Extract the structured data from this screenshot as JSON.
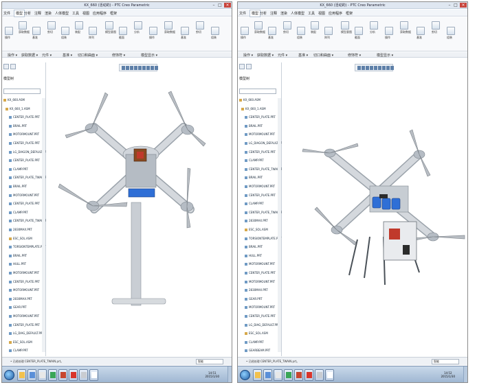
{
  "windows": [
    {
      "title": "KX_660 (活动的) - PTC Creo Parametric",
      "menu": [
        "文件",
        "模型",
        "分析",
        "注释",
        "渲染",
        "人体模型",
        "工具",
        "视图",
        "应用程序",
        "框架"
      ],
      "active_menu": 1,
      "ribbon_labels": [
        "操作",
        "获取数据",
        "基准",
        "剪切",
        "组装",
        "装配",
        "阵列",
        "模型意图",
        "截面",
        "分析"
      ],
      "group_labels": [
        "操作 ▾",
        "获取数据 ▾",
        "元件 ▾",
        "基准 ▾",
        "切口和曲面 ▾",
        "修饰符 ▾",
        "模型显示 ▾"
      ],
      "nav_header": "模型树",
      "tree": [
        {
          "label": "KX_660.ASM",
          "type": "asm"
        },
        {
          "label": "KX_660_1.ASM",
          "type": "asm"
        },
        {
          "label": "CENTER_PLATE.PRT",
          "type": "prt"
        },
        {
          "label": "BRAIL.PRT",
          "type": "prt"
        },
        {
          "label": "MOTORMOUNT.PRT",
          "type": "prt"
        },
        {
          "label": "CENTER_PLATE.PRT",
          "type": "prt"
        },
        {
          "label": "LG_DIAGON_DEFAULT.PRT",
          "type": "prt"
        },
        {
          "label": "CENTER_PLATE.PRT",
          "type": "prt"
        },
        {
          "label": "CLAMP.PRT",
          "type": "prt"
        },
        {
          "label": "CENTER_PLATE_TWAIN.PRT",
          "type": "prt"
        },
        {
          "label": "BRAIL.PRT",
          "type": "prt"
        },
        {
          "label": "MOTORMOUNT.PRT",
          "type": "prt"
        },
        {
          "label": "CENTER_PLATE.PRT",
          "type": "prt"
        },
        {
          "label": "CLAMP.PRT",
          "type": "prt"
        },
        {
          "label": "CENTER_PLATE_TWAIN.PRT",
          "type": "prt"
        },
        {
          "label": "2830MAX.PRT",
          "type": "prt"
        },
        {
          "label": "ESC_SOL.ASM",
          "type": "asm"
        },
        {
          "label": "TORSIONTEMPLATE.PRT",
          "type": "prt"
        },
        {
          "label": "BRAIL.PRT",
          "type": "prt"
        },
        {
          "label": "HULL.PRT",
          "type": "prt"
        },
        {
          "label": "MOTORMOUNT.PRT",
          "type": "prt"
        },
        {
          "label": "CENTER_PLATE.PRT",
          "type": "prt"
        },
        {
          "label": "MOTORMOUNT.PRT",
          "type": "prt"
        },
        {
          "label": "2830MAX.PRT",
          "type": "prt"
        },
        {
          "label": "GEAR.PRT",
          "type": "prt"
        },
        {
          "label": "MOTORMOUNT.PRT",
          "type": "prt"
        },
        {
          "label": "CENTER_PLATE.PRT",
          "type": "prt"
        },
        {
          "label": "LG_DIAG_DEFAULT.PRT",
          "type": "prt"
        },
        {
          "label": "ESC_SOL.ASM",
          "type": "asm"
        },
        {
          "label": "CLAMP.PRT",
          "type": "prt"
        },
        {
          "label": "GEARBEAM.PRT",
          "type": "prt"
        }
      ],
      "status": "• 已经处理 CENTER_PLATE_TWAIN.prt。",
      "selector": "智能",
      "clock": [
        "14:51",
        "2015/1/30"
      ]
    },
    {
      "title": "KX_660 (活动的) - PTC Creo Parametric",
      "menu": [
        "文件",
        "模型",
        "分析",
        "注释",
        "渲染",
        "人体模型",
        "工具",
        "视图",
        "应用程序",
        "框架"
      ],
      "active_menu": 1,
      "ribbon_labels": [
        "操作",
        "获取数据",
        "基准",
        "剪切",
        "组装",
        "装配",
        "阵列",
        "模型意图",
        "截面",
        "分析"
      ],
      "group_labels": [
        "操作 ▾",
        "获取数据 ▾",
        "元件 ▾",
        "基准 ▾",
        "切口和曲面 ▾",
        "修饰符 ▾",
        "模型显示 ▾"
      ],
      "nav_header": "模型树",
      "tree": [
        {
          "label": "KX_660.ASM",
          "type": "asm"
        },
        {
          "label": "KX_660_1.ASM",
          "type": "asm"
        },
        {
          "label": "CENTER_PLATE.PRT",
          "type": "prt"
        },
        {
          "label": "BRAIL.PRT",
          "type": "prt"
        },
        {
          "label": "MOTORMOUNT.PRT",
          "type": "prt"
        },
        {
          "label": "LG_DIAGON_DEFAULT.PRT",
          "type": "prt"
        },
        {
          "label": "CENTER_PLATE.PRT",
          "type": "prt"
        },
        {
          "label": "CLAMP.PRT",
          "type": "prt"
        },
        {
          "label": "CENTER_PLATE_TWAIN.PRT",
          "type": "prt"
        },
        {
          "label": "BRAIL.PRT",
          "type": "prt"
        },
        {
          "label": "MOTORMOUNT.PRT",
          "type": "prt"
        },
        {
          "label": "CENTER_PLATE.PRT",
          "type": "prt"
        },
        {
          "label": "CLAMP.PRT",
          "type": "prt"
        },
        {
          "label": "CENTER_PLATE_TWAIN.PRT",
          "type": "prt"
        },
        {
          "label": "2830MAX.PRT",
          "type": "prt"
        },
        {
          "label": "ESC_SOL.ASM",
          "type": "asm"
        },
        {
          "label": "TORSIONTEMPLATE.PRT",
          "type": "prt"
        },
        {
          "label": "BRAIL.PRT",
          "type": "prt"
        },
        {
          "label": "HULL.PRT",
          "type": "prt"
        },
        {
          "label": "MOTORMOUNT.PRT",
          "type": "prt"
        },
        {
          "label": "CENTER_PLATE.PRT",
          "type": "prt"
        },
        {
          "label": "MOTORMOUNT.PRT",
          "type": "prt"
        },
        {
          "label": "2830MAX.PRT",
          "type": "prt"
        },
        {
          "label": "GEAR.PRT",
          "type": "prt"
        },
        {
          "label": "MOTORMOUNT.PRT",
          "type": "prt"
        },
        {
          "label": "CENTER_PLATE.PRT",
          "type": "prt"
        },
        {
          "label": "LG_DIAG_DEFAULT.PRT",
          "type": "prt"
        },
        {
          "label": "ESC_SOL.ASM",
          "type": "asm"
        },
        {
          "label": "CLAMP.PRT",
          "type": "prt"
        },
        {
          "label": "GEARBEAM.PRT",
          "type": "prt"
        }
      ],
      "status": "• 已经处理 CENTER_PLATE_TWAIN.prt。",
      "selector": "智能",
      "clock": [
        "14:52",
        "2015/1/30"
      ]
    }
  ],
  "colors": {
    "arm": "#d4d8dd",
    "blade": "#b9bec4",
    "battery": "#2f6fd6",
    "accent_red": "#c0392b",
    "hub": "#b5bcc4"
  },
  "icons": [
    "start-orb-icon",
    "taskbar-app-icon",
    "window-minimize-icon",
    "window-maximize-icon",
    "window-close-icon"
  ]
}
